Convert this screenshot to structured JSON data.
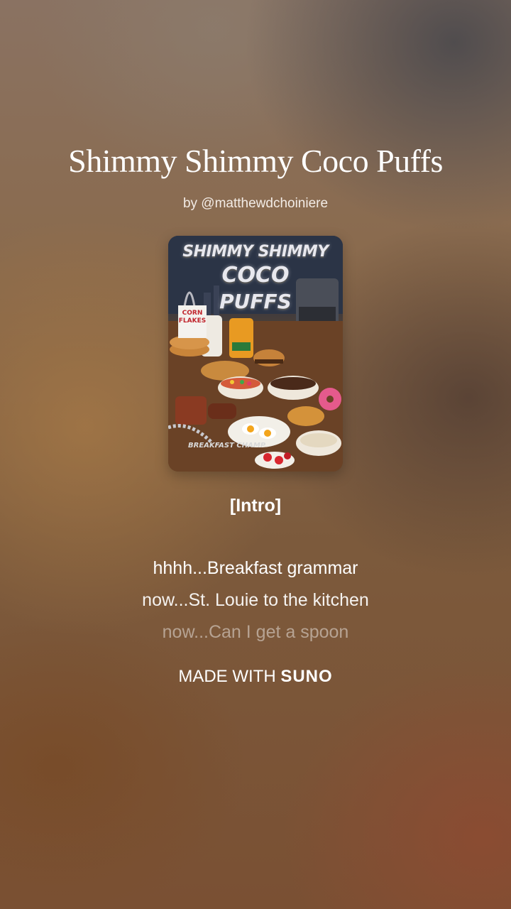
{
  "song": {
    "title": "Shimmy Shimmy Coco Puffs",
    "artist": "by @matthewdchoiniere"
  },
  "cover_art": {
    "title_line1": "SHIMMY SHIMMY",
    "title_line2": "COCO",
    "title_line3": "PUFFS",
    "cereal_box": "CORN FLAKES",
    "bottom_text": "BREAKFAST CHAMP"
  },
  "lyrics": {
    "section": "[Intro]",
    "lines": [
      "hhhh...Breakfast grammar",
      "now...St. Louie to the kitchen",
      "now...Can I get a spoon"
    ]
  },
  "footer": {
    "prefix": "MADE WITH ",
    "brand": "SUNO"
  }
}
